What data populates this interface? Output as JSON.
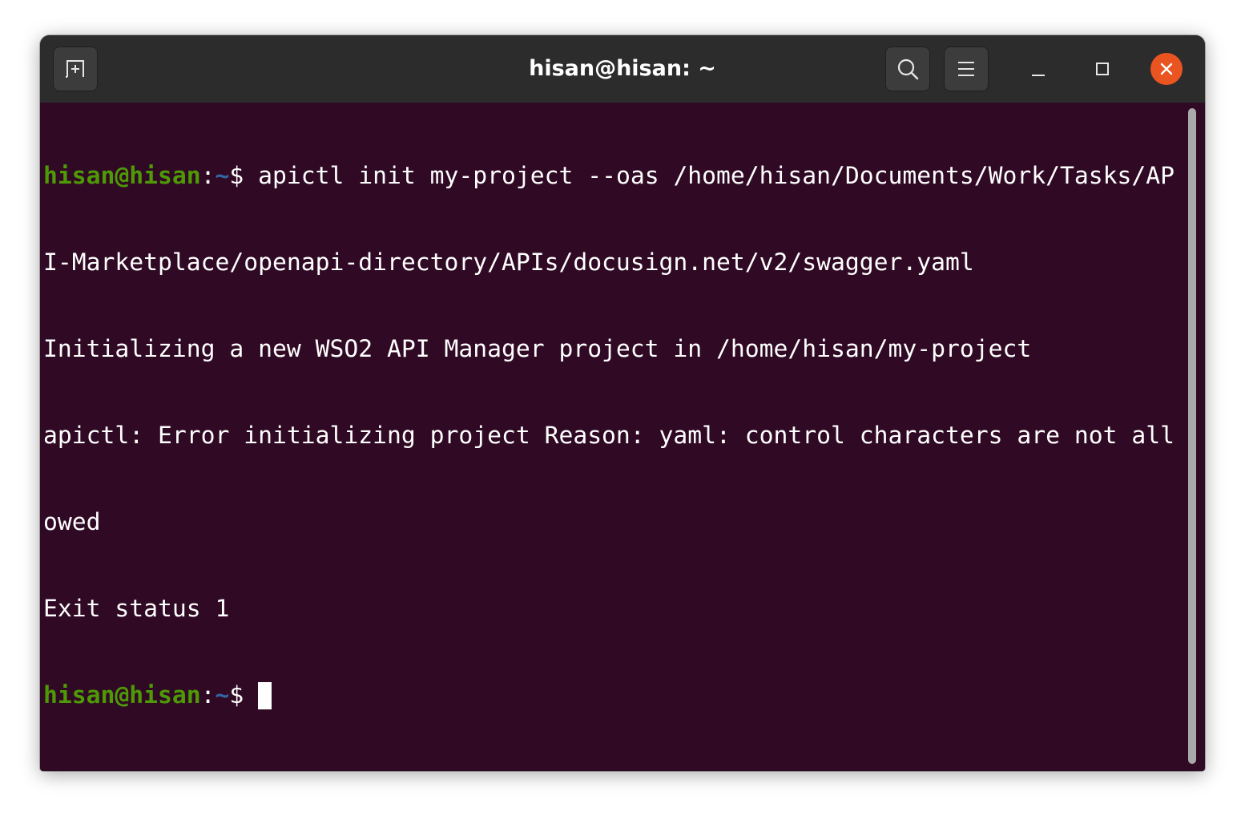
{
  "window": {
    "title": "hisan@hisan: ~"
  },
  "icons": {
    "new_tab": "new-tab-icon",
    "search": "search-icon",
    "menu": "hamburger-menu-icon",
    "minimize": "minimize-icon",
    "maximize": "maximize-icon",
    "close": "close-icon"
  },
  "colors": {
    "terminal_bg": "#300a24",
    "prompt_user": "#4e9a06",
    "prompt_path": "#3465a4",
    "close_button": "#e95420"
  },
  "terminal": {
    "prompt": {
      "user_host": "hisan@hisan",
      "colon": ":",
      "path": "~",
      "symbol": "$ "
    },
    "command": "apictl init my-project --oas /home/hisan/Documents/Work/Tasks/AP",
    "lines": [
      "I-Marketplace/openapi-directory/APIs/docusign.net/v2/swagger.yaml",
      "Initializing a new WSO2 API Manager project in /home/hisan/my-project",
      "apictl: Error initializing project Reason: yaml: control characters are not all",
      "owed",
      "Exit status 1"
    ]
  }
}
